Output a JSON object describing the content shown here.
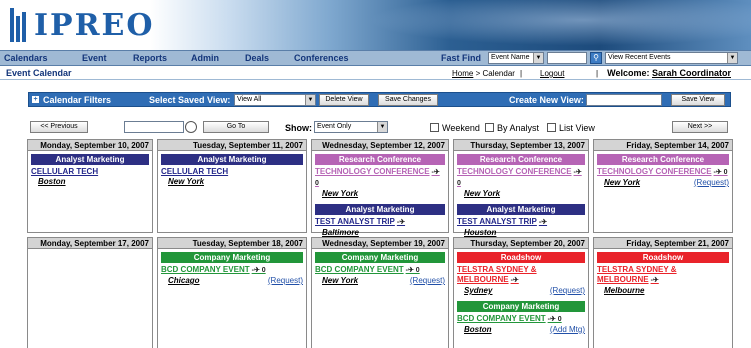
{
  "brand": {
    "logo_text": "IPREO"
  },
  "nav": {
    "items": [
      "Calendars",
      "Event",
      "Reports",
      "Admin",
      "Deals",
      "Conferences"
    ],
    "fast_find_label": "Fast Find",
    "fast_find_select": "Event Name",
    "recent_select": "View Recent Events"
  },
  "titlebar": {
    "page_title": "Event Calendar",
    "home": "Home",
    "crumb_rest": "> Calendar",
    "sep": "|",
    "logout": "Logout",
    "welcome_prefix": "Welcome:",
    "user": "Sarah Coordinator"
  },
  "filter": {
    "toggle": "+",
    "label": "Calendar Filters",
    "saved_view_label": "Select Saved View:",
    "saved_view_value": "View All",
    "delete_view": "Delete View",
    "save_changes": "Save Changes",
    "create_label": "Create New View:",
    "save_view": "Save View"
  },
  "toolbar": {
    "previous": "<< Previous",
    "goto": "Go To",
    "show_label": "Show:",
    "show_value": "Event Only",
    "weekend": "Weekend",
    "by_analyst": "By Analyst",
    "list_view": "List View",
    "next": "Next >>"
  },
  "weeks": [
    {
      "days": [
        {
          "header": "Monday, September 10, 2007",
          "blocks": [
            {
              "category": "Analyst Marketing",
              "kind": "analyst",
              "title": "CELLULAR TECH",
              "icons": "",
              "location": "Boston",
              "link": ""
            }
          ]
        },
        {
          "header": "Tuesday, September 11, 2007",
          "blocks": [
            {
              "category": "Analyst Marketing",
              "kind": "analyst",
              "title": "CELLULAR TECH",
              "icons": "",
              "location": "New York",
              "link": ""
            }
          ]
        },
        {
          "header": "Wednesday, September 12, 2007",
          "blocks": [
            {
              "category": "Research Conference",
              "kind": "research",
              "title": "TECHNOLOGY CONFERENCE",
              "icons": "-✈ 0",
              "location": "New York",
              "link": ""
            },
            {
              "category": "Analyst Marketing",
              "kind": "analyst",
              "title": "TEST ANALYST TRIP",
              "icons": "-✈",
              "location": "Baltimore",
              "link": ""
            }
          ]
        },
        {
          "header": "Thursday, September 13, 2007",
          "blocks": [
            {
              "category": "Research Conference",
              "kind": "research",
              "title": "TECHNOLOGY CONFERENCE",
              "icons": "-✈ 0",
              "location": "New York",
              "link": ""
            },
            {
              "category": "Analyst Marketing",
              "kind": "analyst",
              "title": "TEST ANALYST TRIP",
              "icons": "-✈",
              "location": "Houston",
              "link": ""
            }
          ]
        },
        {
          "header": "Friday, September 14, 2007",
          "blocks": [
            {
              "category": "Research Conference",
              "kind": "research",
              "title": "TECHNOLOGY CONFERENCE",
              "icons": "-✈ 0",
              "location": "New York",
              "link": "(Request)"
            }
          ]
        }
      ]
    },
    {
      "days": [
        {
          "header": "Monday, September 17, 2007",
          "blocks": []
        },
        {
          "header": "Tuesday, September 18, 2007",
          "blocks": [
            {
              "category": "Company Marketing",
              "kind": "company",
              "title": "BCD COMPANY EVENT",
              "icons": "-✈ 0",
              "location": "Chicago",
              "link": "(Request)"
            }
          ]
        },
        {
          "header": "Wednesday, September 19, 2007",
          "blocks": [
            {
              "category": "Company Marketing",
              "kind": "company",
              "title": "BCD COMPANY EVENT",
              "icons": "-✈ 0",
              "location": "New York",
              "link": "(Request)"
            }
          ]
        },
        {
          "header": "Thursday, September 20, 2007",
          "blocks": [
            {
              "category": "Roadshow",
              "kind": "roadshow",
              "title": "TELSTRA SYDNEY & MELBOURNE",
              "icons": "-✈",
              "location": "Sydney",
              "link": "(Request)"
            },
            {
              "category": "Company Marketing",
              "kind": "company",
              "title": "BCD COMPANY EVENT",
              "icons": "-✈ 0",
              "location": "Boston",
              "link": "(Add Mtg)"
            }
          ]
        },
        {
          "header": "Friday, September 21, 2007",
          "blocks": [
            {
              "category": "Roadshow",
              "kind": "roadshow",
              "title": "TELSTRA SYDNEY & MELBOURNE",
              "icons": "-✈",
              "location": "Melbourne",
              "link": ""
            }
          ]
        }
      ]
    }
  ],
  "colors": {
    "analyst": "#2d2f83",
    "research": "#b664b5",
    "company": "#22963a",
    "roadshow": "#e9232a",
    "filter_bar": "#2f6db5",
    "nav_bar": "#9fb9d4"
  }
}
